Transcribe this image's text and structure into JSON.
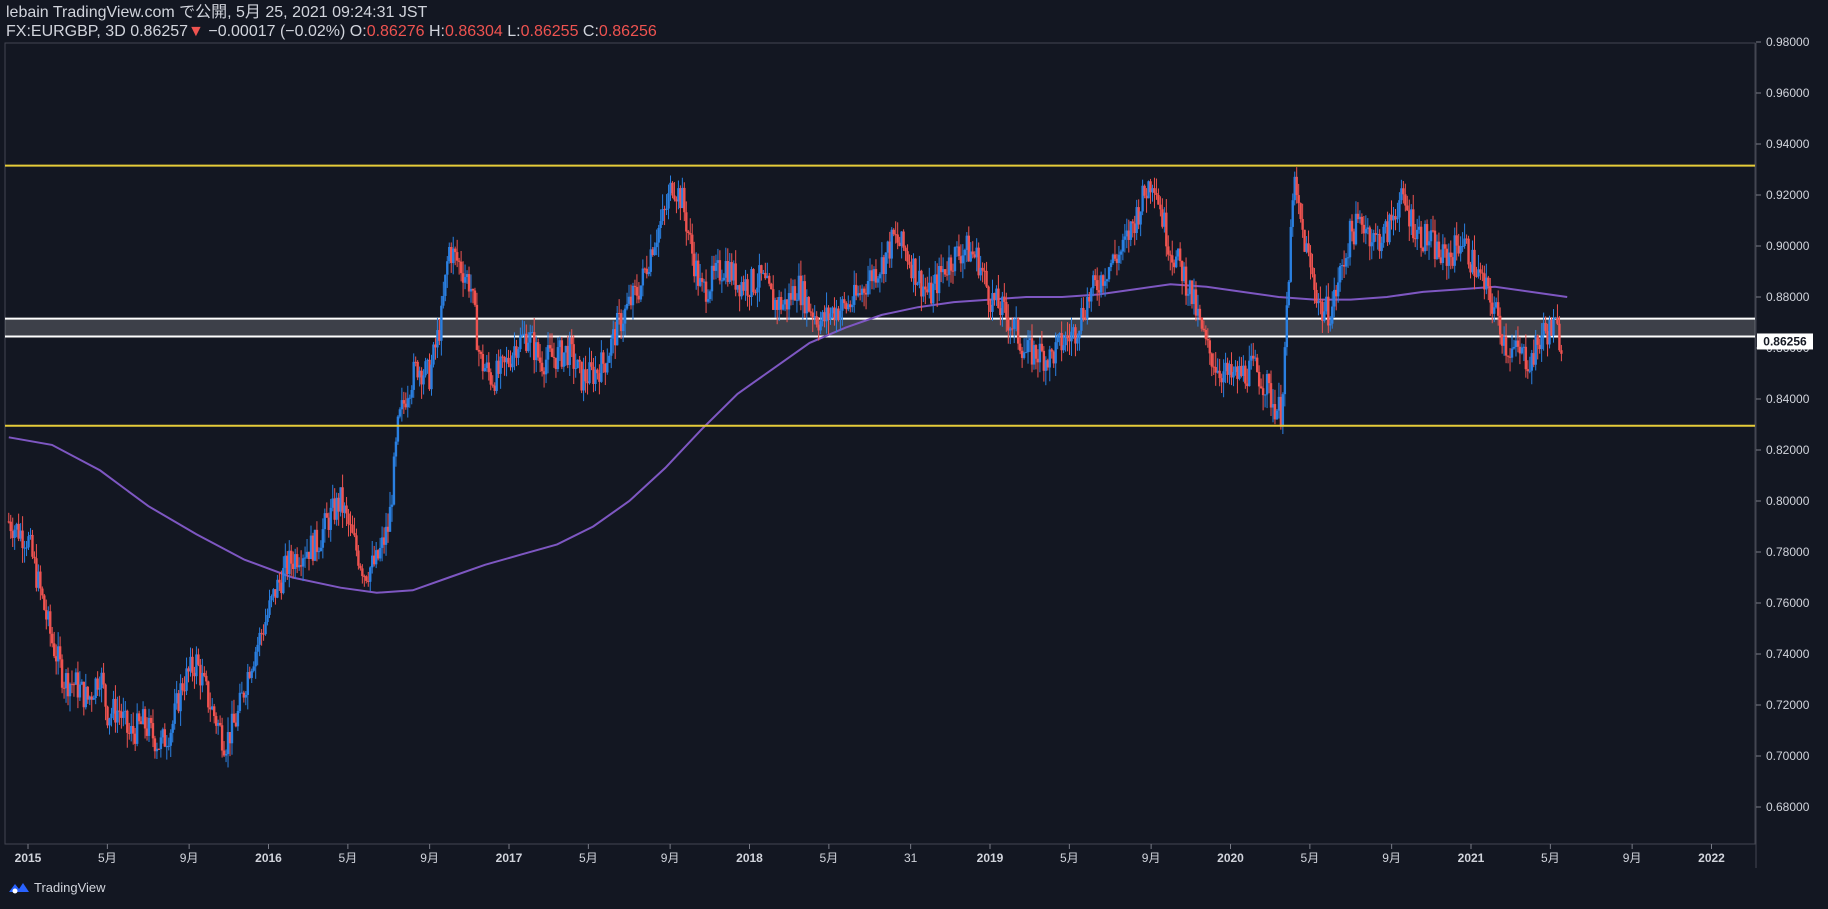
{
  "header": {
    "line1": "lebain TradingView.com で公開, 5月 25, 2021 09:24:31 JST",
    "symbol": "FX:EURGBP, 3D",
    "last": "0.86257",
    "change": "−0.00017 (−0.02%)",
    "o_label": "O:",
    "o": "0.86276",
    "h_label": "H:",
    "h": "0.86304",
    "l_label": "L:",
    "l": "0.86255",
    "c_label": "C:",
    "c": "0.86256"
  },
  "brand": {
    "name": "TradingView"
  },
  "price_label": "0.86256",
  "colors": {
    "bg": "#131722",
    "up": "#2a7fe0",
    "down": "#ef5350",
    "ma": "#7e57c2",
    "support": "#e6cc3a",
    "zone": "#ffffff"
  },
  "chart_data": {
    "type": "candlestick",
    "symbol": "FX:EURGBP",
    "interval": "3D",
    "ylim": [
      0.67,
      0.98
    ],
    "y_ticks": [
      "0.68000",
      "0.70000",
      "0.72000",
      "0.74000",
      "0.76000",
      "0.78000",
      "0.80000",
      "0.82000",
      "0.84000",
      "0.86000",
      "0.88000",
      "0.90000",
      "0.92000",
      "0.94000",
      "0.96000",
      "0.98000"
    ],
    "x_ticks": [
      {
        "label": "2015",
        "bold": true,
        "t": 2015.0
      },
      {
        "label": "5月",
        "bold": false,
        "t": 2015.33
      },
      {
        "label": "9月",
        "bold": false,
        "t": 2015.67
      },
      {
        "label": "2016",
        "bold": true,
        "t": 2016.0
      },
      {
        "label": "5月",
        "bold": false,
        "t": 2016.33
      },
      {
        "label": "9月",
        "bold": false,
        "t": 2016.67
      },
      {
        "label": "2017",
        "bold": true,
        "t": 2017.0
      },
      {
        "label": "5月",
        "bold": false,
        "t": 2017.33
      },
      {
        "label": "9月",
        "bold": false,
        "t": 2017.67
      },
      {
        "label": "2018",
        "bold": true,
        "t": 2018.0
      },
      {
        "label": "5月",
        "bold": false,
        "t": 2018.33
      },
      {
        "label": "31",
        "bold": false,
        "t": 2018.67
      },
      {
        "label": "2019",
        "bold": true,
        "t": 2019.0
      },
      {
        "label": "5月",
        "bold": false,
        "t": 2019.33
      },
      {
        "label": "9月",
        "bold": false,
        "t": 2019.67
      },
      {
        "label": "2020",
        "bold": true,
        "t": 2020.0
      },
      {
        "label": "5月",
        "bold": false,
        "t": 2020.33
      },
      {
        "label": "9月",
        "bold": false,
        "t": 2020.67
      },
      {
        "label": "2021",
        "bold": true,
        "t": 2021.0
      },
      {
        "label": "5月",
        "bold": false,
        "t": 2021.33
      },
      {
        "label": "9月",
        "bold": false,
        "t": 2021.67
      },
      {
        "label": "2022",
        "bold": true,
        "t": 2022.0
      }
    ],
    "horizontal_lines": [
      {
        "price": 0.9315,
        "color": "#e6cc3a"
      },
      {
        "price": 0.8295,
        "color": "#e6cc3a"
      }
    ],
    "zone": {
      "top": 0.8715,
      "bottom": 0.8645
    },
    "price_path": [
      [
        2014.92,
        0.792
      ],
      [
        2015.0,
        0.785
      ],
      [
        2015.05,
        0.765
      ],
      [
        2015.1,
        0.745
      ],
      [
        2015.15,
        0.73
      ],
      [
        2015.2,
        0.728
      ],
      [
        2015.25,
        0.722
      ],
      [
        2015.3,
        0.733
      ],
      [
        2015.33,
        0.717
      ],
      [
        2015.38,
        0.718
      ],
      [
        2015.42,
        0.708
      ],
      [
        2015.48,
        0.713
      ],
      [
        2015.55,
        0.704
      ],
      [
        2015.6,
        0.712
      ],
      [
        2015.64,
        0.728
      ],
      [
        2015.7,
        0.737
      ],
      [
        2015.75,
        0.722
      ],
      [
        2015.82,
        0.705
      ],
      [
        2015.87,
        0.715
      ],
      [
        2015.92,
        0.735
      ],
      [
        2015.97,
        0.748
      ],
      [
        2016.03,
        0.765
      ],
      [
        2016.08,
        0.775
      ],
      [
        2016.13,
        0.78
      ],
      [
        2016.2,
        0.783
      ],
      [
        2016.25,
        0.793
      ],
      [
        2016.3,
        0.8
      ],
      [
        2016.35,
        0.785
      ],
      [
        2016.4,
        0.772
      ],
      [
        2016.45,
        0.776
      ],
      [
        2016.5,
        0.79
      ],
      [
        2016.54,
        0.83
      ],
      [
        2016.58,
        0.845
      ],
      [
        2016.62,
        0.853
      ],
      [
        2016.67,
        0.849
      ],
      [
        2016.72,
        0.872
      ],
      [
        2016.75,
        0.899
      ],
      [
        2016.8,
        0.892
      ],
      [
        2016.84,
        0.885
      ],
      [
        2016.88,
        0.855
      ],
      [
        2016.93,
        0.848
      ],
      [
        2016.98,
        0.852
      ],
      [
        2017.03,
        0.862
      ],
      [
        2017.08,
        0.865
      ],
      [
        2017.13,
        0.855
      ],
      [
        2017.2,
        0.857
      ],
      [
        2017.25,
        0.859
      ],
      [
        2017.3,
        0.848
      ],
      [
        2017.35,
        0.85
      ],
      [
        2017.4,
        0.855
      ],
      [
        2017.45,
        0.868
      ],
      [
        2017.5,
        0.877
      ],
      [
        2017.55,
        0.885
      ],
      [
        2017.6,
        0.902
      ],
      [
        2017.65,
        0.913
      ],
      [
        2017.68,
        0.925
      ],
      [
        2017.72,
        0.918
      ],
      [
        2017.76,
        0.898
      ],
      [
        2017.8,
        0.882
      ],
      [
        2017.85,
        0.887
      ],
      [
        2017.9,
        0.893
      ],
      [
        2017.95,
        0.886
      ],
      [
        2018.0,
        0.885
      ],
      [
        2018.05,
        0.887
      ],
      [
        2018.1,
        0.878
      ],
      [
        2018.15,
        0.877
      ],
      [
        2018.2,
        0.885
      ],
      [
        2018.25,
        0.876
      ],
      [
        2018.3,
        0.87
      ],
      [
        2018.35,
        0.875
      ],
      [
        2018.4,
        0.876
      ],
      [
        2018.45,
        0.88
      ],
      [
        2018.5,
        0.888
      ],
      [
        2018.55,
        0.893
      ],
      [
        2018.6,
        0.903
      ],
      [
        2018.65,
        0.898
      ],
      [
        2018.7,
        0.888
      ],
      [
        2018.75,
        0.88
      ],
      [
        2018.8,
        0.89
      ],
      [
        2018.85,
        0.896
      ],
      [
        2018.9,
        0.899
      ],
      [
        2018.95,
        0.895
      ],
      [
        2019.0,
        0.88
      ],
      [
        2019.05,
        0.875
      ],
      [
        2019.1,
        0.868
      ],
      [
        2019.15,
        0.858
      ],
      [
        2019.2,
        0.858
      ],
      [
        2019.25,
        0.856
      ],
      [
        2019.3,
        0.862
      ],
      [
        2019.35,
        0.866
      ],
      [
        2019.4,
        0.878
      ],
      [
        2019.45,
        0.886
      ],
      [
        2019.5,
        0.893
      ],
      [
        2019.55,
        0.898
      ],
      [
        2019.6,
        0.91
      ],
      [
        2019.65,
        0.922
      ],
      [
        2019.68,
        0.928
      ],
      [
        2019.72,
        0.91
      ],
      [
        2019.75,
        0.899
      ],
      [
        2019.8,
        0.89
      ],
      [
        2019.83,
        0.883
      ],
      [
        2019.87,
        0.87
      ],
      [
        2019.9,
        0.86
      ],
      [
        2019.95,
        0.852
      ],
      [
        2020.0,
        0.848
      ],
      [
        2020.05,
        0.85
      ],
      [
        2020.1,
        0.852
      ],
      [
        2020.15,
        0.845
      ],
      [
        2020.18,
        0.838
      ],
      [
        2020.21,
        0.835
      ],
      [
        2020.24,
        0.88
      ],
      [
        2020.26,
        0.925
      ],
      [
        2020.3,
        0.905
      ],
      [
        2020.34,
        0.888
      ],
      [
        2020.38,
        0.874
      ],
      [
        2020.42,
        0.875
      ],
      [
        2020.46,
        0.89
      ],
      [
        2020.5,
        0.905
      ],
      [
        2020.55,
        0.91
      ],
      [
        2020.6,
        0.902
      ],
      [
        2020.65,
        0.905
      ],
      [
        2020.7,
        0.918
      ],
      [
        2020.73,
        0.915
      ],
      [
        2020.78,
        0.905
      ],
      [
        2020.83,
        0.902
      ],
      [
        2020.88,
        0.895
      ],
      [
        2020.92,
        0.897
      ],
      [
        2020.96,
        0.903
      ],
      [
        2021.0,
        0.895
      ],
      [
        2021.05,
        0.885
      ],
      [
        2021.1,
        0.875
      ],
      [
        2021.15,
        0.86
      ],
      [
        2021.2,
        0.858
      ],
      [
        2021.25,
        0.855
      ],
      [
        2021.3,
        0.866
      ],
      [
        2021.35,
        0.868
      ],
      [
        2021.38,
        0.862
      ]
    ],
    "ma_path": [
      [
        2014.92,
        0.825
      ],
      [
        2015.1,
        0.822
      ],
      [
        2015.3,
        0.812
      ],
      [
        2015.5,
        0.798
      ],
      [
        2015.7,
        0.787
      ],
      [
        2015.9,
        0.777
      ],
      [
        2016.1,
        0.77
      ],
      [
        2016.3,
        0.766
      ],
      [
        2016.45,
        0.764
      ],
      [
        2016.6,
        0.765
      ],
      [
        2016.75,
        0.77
      ],
      [
        2016.9,
        0.775
      ],
      [
        2017.05,
        0.779
      ],
      [
        2017.2,
        0.783
      ],
      [
        2017.35,
        0.79
      ],
      [
        2017.5,
        0.8
      ],
      [
        2017.65,
        0.813
      ],
      [
        2017.8,
        0.828
      ],
      [
        2017.95,
        0.842
      ],
      [
        2018.1,
        0.852
      ],
      [
        2018.25,
        0.862
      ],
      [
        2018.4,
        0.868
      ],
      [
        2018.55,
        0.873
      ],
      [
        2018.7,
        0.876
      ],
      [
        2018.85,
        0.878
      ],
      [
        2019.0,
        0.879
      ],
      [
        2019.15,
        0.88
      ],
      [
        2019.3,
        0.88
      ],
      [
        2019.45,
        0.881
      ],
      [
        2019.6,
        0.883
      ],
      [
        2019.75,
        0.885
      ],
      [
        2019.9,
        0.884
      ],
      [
        2020.05,
        0.882
      ],
      [
        2020.2,
        0.88
      ],
      [
        2020.35,
        0.879
      ],
      [
        2020.5,
        0.879
      ],
      [
        2020.65,
        0.88
      ],
      [
        2020.8,
        0.882
      ],
      [
        2020.95,
        0.883
      ],
      [
        2021.1,
        0.884
      ],
      [
        2021.25,
        0.882
      ],
      [
        2021.4,
        0.88
      ]
    ]
  }
}
